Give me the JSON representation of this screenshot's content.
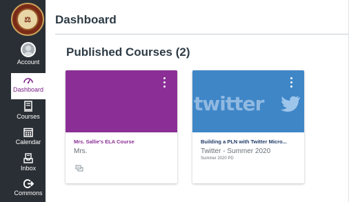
{
  "nav": {
    "account_label": "Account",
    "dashboard_label": "Dashboard",
    "courses_label": "Courses",
    "calendar_label": "Calendar",
    "inbox_label": "Inbox",
    "commons_label": "Commons",
    "active_item": "Dashboard",
    "accent_color": "#7a1f86"
  },
  "header": {
    "title": "Dashboard"
  },
  "section": {
    "title": "Published Courses (2)"
  },
  "cards": [
    {
      "title": "Mrs. Sallie's ELA Course",
      "subtitle": "Mrs.",
      "term": "",
      "hero_color": "#8b2f96",
      "icon": "discussion-icon"
    },
    {
      "title": "Building a PLN with Twitter Micro...",
      "subtitle": "Twitter - Summer 2020",
      "term": "Summer 2020 PD",
      "hero_color": "#3f86c7",
      "hero_image_text": "twitter"
    }
  ]
}
